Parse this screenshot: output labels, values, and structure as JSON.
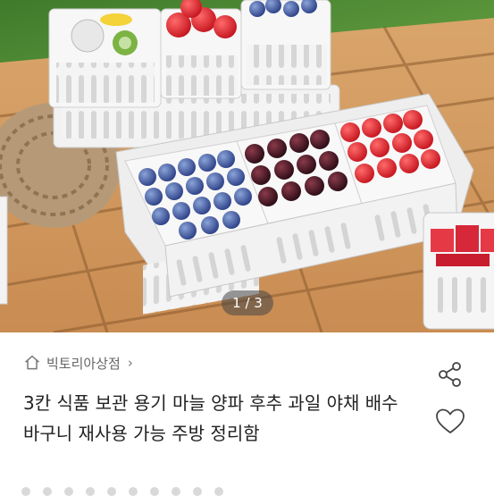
{
  "photo": {
    "pager": "1 / 3"
  },
  "store": {
    "icon": "home-icon",
    "name": "빅토리아상점",
    "chevron": "›"
  },
  "product": {
    "title": "3칸 식품 보관 용기 마늘 양파 후추 과일 야채 배수 바구니 재사용 가능 주방 정리함"
  },
  "actions": {
    "share_icon": "share-icon",
    "like_icon": "heart-icon"
  }
}
